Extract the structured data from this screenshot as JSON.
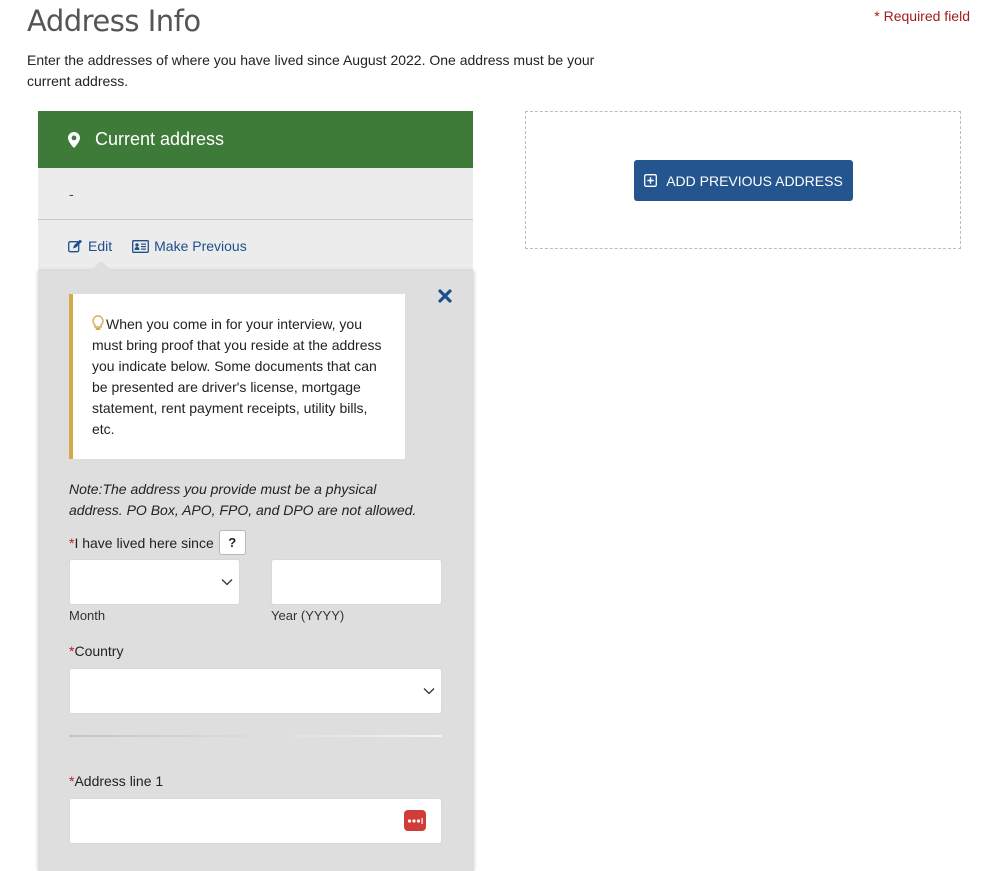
{
  "page": {
    "title": "Address Info",
    "required_note": "* Required field",
    "intro": "Enter the addresses of where you have lived since August 2022. One address must be your current address."
  },
  "current_card": {
    "header": "Current address",
    "header_icon": "map-marker-icon",
    "address_value": "-",
    "actions": {
      "edit": "Edit",
      "make_previous": "Make Previous"
    },
    "colors": {
      "header_bg": "#3e7b39",
      "link": "#1f4f8a"
    }
  },
  "edit_form": {
    "close_icon": "close-icon",
    "tip": "When you come in for your interview, you must bring proof that you reside at the address you indicate below. Some documents that can be presented are driver's license, mortgage statement, rent payment receipts, utility bills, etc.",
    "note": "Note:The address you provide must be a physical address. PO Box, APO, FPO, and DPO are not allowed.",
    "lived_since": {
      "required_mark": "*",
      "label": "I have lived here since",
      "help": "?",
      "month": {
        "value": "",
        "sub_label": "Month"
      },
      "year": {
        "value": "",
        "sub_label": "Year (YYYY)"
      }
    },
    "country": {
      "required_mark": "*",
      "label": "Country",
      "value": ""
    },
    "address_line1": {
      "required_mark": "*",
      "label": "Address line 1",
      "value": ""
    }
  },
  "previous": {
    "add_button": "Add Previous Address",
    "colors": {
      "button_bg": "#24558f"
    }
  }
}
